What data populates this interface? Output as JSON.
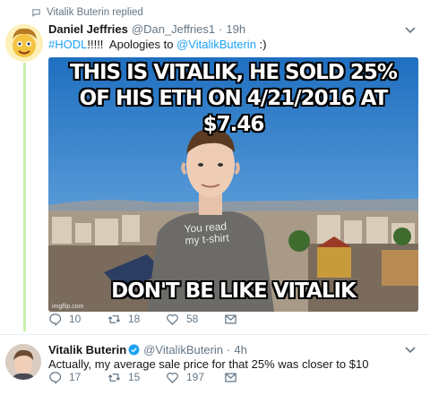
{
  "context": {
    "text": "Vitalik Buterin replied",
    "icon": "comment-icon"
  },
  "tweet1": {
    "name": "Daniel Jeffries",
    "handle": "@Dan_Jeffries1",
    "dot": "·",
    "time": "19h",
    "hashtag": "#HODL",
    "text_mid": "!!!!!  Apologies to ",
    "mention": "@VitalikButerin",
    "text_end": " :)",
    "media": {
      "caption_line1": "THIS IS VITALIK, HE SOLD 25%",
      "caption_line2": "OF HIS ETH ON 4/21/2016 AT $7.46",
      "caption_bottom": "DON'T BE LIKE VITALIK",
      "shirt_text_1": "You read",
      "shirt_text_2": "my t-shirt",
      "watermark": "imgflip.com"
    },
    "actions": {
      "replies": "10",
      "retweets": "18",
      "likes": "58"
    }
  },
  "tweet2": {
    "name": "Vitalik Buterin",
    "handle": "@VitalikButerin",
    "dot": "·",
    "time": "4h",
    "text": "Actually, my average sale price for that 25% was closer to $10",
    "actions": {
      "replies": "17",
      "retweets": "15",
      "likes": "197"
    }
  },
  "colors": {
    "accent": "#1da1f2",
    "thread": "#c8f0ae",
    "muted": "#657786"
  }
}
